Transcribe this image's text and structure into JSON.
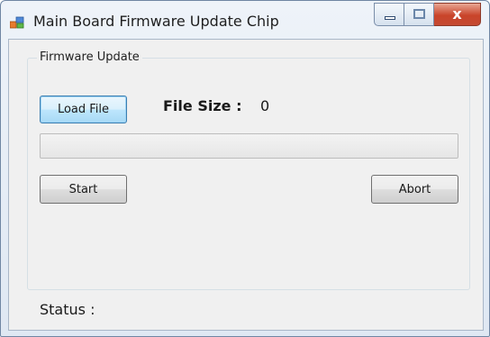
{
  "window": {
    "title": "Main Board Firmware Update Chip",
    "icon": "app-window-icon",
    "controls": {
      "minimize_icon": "minimize-icon",
      "maximize_icon": "maximize-icon",
      "close_icon": "close-icon",
      "close_glyph": "x"
    }
  },
  "group": {
    "label": "Firmware Update"
  },
  "buttons": {
    "load_file": "Load File",
    "start": "Start",
    "abort": "Abort"
  },
  "file_size": {
    "label": "File Size :",
    "value": "0"
  },
  "progress": {
    "value_percent": 0
  },
  "status": {
    "label": "Status :"
  },
  "colors": {
    "close_button": "#c9442a",
    "focus_border": "#3c7fb1",
    "client_background": "#f0f0f0"
  }
}
